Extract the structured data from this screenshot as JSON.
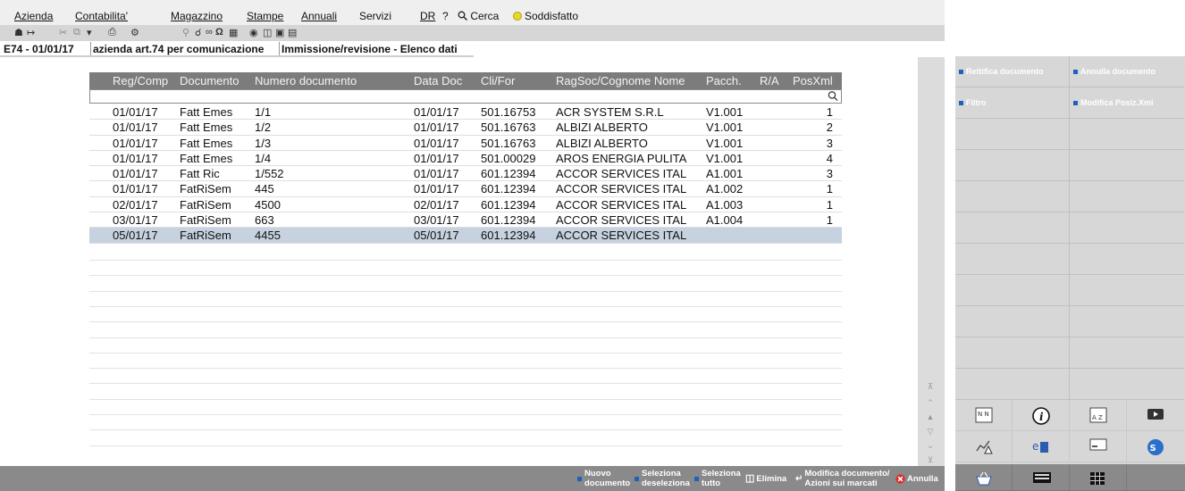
{
  "menu": {
    "items": [
      "Azienda",
      "Contabilita'",
      "Magazzino",
      "Stampe",
      "Annuali",
      "Servizi",
      "DR",
      "?",
      "Cerca",
      "Soddisfatto"
    ]
  },
  "titlebar": {
    "part1": "E74 - 01/01/17",
    "part2": "azienda art.74 per comunicazione",
    "part3": "Immissione/revisione - Elenco dati"
  },
  "table": {
    "columns": [
      "Reg/Comp",
      "Documento",
      "Numero documento",
      "Data Doc",
      "Cli/For",
      "RagSoc/Cognome Nome",
      "Pacch.",
      "R/A",
      "PosXml"
    ],
    "filter_value": "",
    "rows": [
      {
        "reg": "01/01/17",
        "doc": "Fatt Emes",
        "num": "1/1",
        "data": "01/01/17",
        "clifor": "501.16753",
        "ragsoc": "ACR SYSTEM S.R.L",
        "pacch": "V1.001",
        "ra": "",
        "pos": "1"
      },
      {
        "reg": "01/01/17",
        "doc": "Fatt Emes",
        "num": "1/2",
        "data": "01/01/17",
        "clifor": "501.16763",
        "ragsoc": "ALBIZI ALBERTO",
        "pacch": "V1.001",
        "ra": "",
        "pos": "2"
      },
      {
        "reg": "01/01/17",
        "doc": "Fatt Emes",
        "num": "1/3",
        "data": "01/01/17",
        "clifor": "501.16763",
        "ragsoc": "ALBIZI ALBERTO",
        "pacch": "V1.001",
        "ra": "",
        "pos": "3"
      },
      {
        "reg": "01/01/17",
        "doc": "Fatt Emes",
        "num": "1/4",
        "data": "01/01/17",
        "clifor": "501.00029",
        "ragsoc": "AROS ENERGIA PULITA",
        "pacch": "V1.001",
        "ra": "",
        "pos": "4"
      },
      {
        "reg": "01/01/17",
        "doc": "Fatt Ric",
        "num": "1/552",
        "data": "01/01/17",
        "clifor": "601.12394",
        "ragsoc": "ACCOR SERVICES ITAL",
        "pacch": "A1.001",
        "ra": "",
        "pos": "3"
      },
      {
        "reg": "01/01/17",
        "doc": "FatRiSem",
        "num": "445",
        "data": "01/01/17",
        "clifor": "601.12394",
        "ragsoc": "ACCOR SERVICES ITAL",
        "pacch": "A1.002",
        "ra": "",
        "pos": "1"
      },
      {
        "reg": "02/01/17",
        "doc": "FatRiSem",
        "num": "4500",
        "data": "02/01/17",
        "clifor": "601.12394",
        "ragsoc": "ACCOR SERVICES ITAL",
        "pacch": "A1.003",
        "ra": "",
        "pos": "1"
      },
      {
        "reg": "03/01/17",
        "doc": "FatRiSem",
        "num": "663",
        "data": "03/01/17",
        "clifor": "601.12394",
        "ragsoc": "ACCOR SERVICES ITAL",
        "pacch": "A1.004",
        "ra": "",
        "pos": "1"
      },
      {
        "reg": "05/01/17",
        "doc": "FatRiSem",
        "num": "4455",
        "data": "05/01/17",
        "clifor": "601.12394",
        "ragsoc": "ACCOR SERVICES ITAL",
        "pacch": "",
        "ra": "",
        "pos": ""
      }
    ],
    "selected_row": 8
  },
  "actions": {
    "nuovo": [
      "Nuovo",
      "documento"
    ],
    "seleziona": [
      "Seleziona",
      "deseleziona"
    ],
    "seleziona_tutto": [
      "Seleziona",
      "tutto"
    ],
    "elimina": "Elimina",
    "modifica": [
      "Modifica documento/",
      "Azioni sui marcati"
    ],
    "annulla": "Annulla"
  },
  "side": {
    "rettifica": "Rettifica documento",
    "annulla_doc": "Annulla documento",
    "filtro": "Filtro",
    "modifica_posiz": "Modifica Posiz.Xml"
  },
  "colors": {
    "header_bg": "#7c7c7c",
    "selected_row": "#c6d2df",
    "action_bar": "#8a8a8a",
    "accent_blue": "#1f5fbf",
    "side_panel": "#d7d7d7"
  }
}
